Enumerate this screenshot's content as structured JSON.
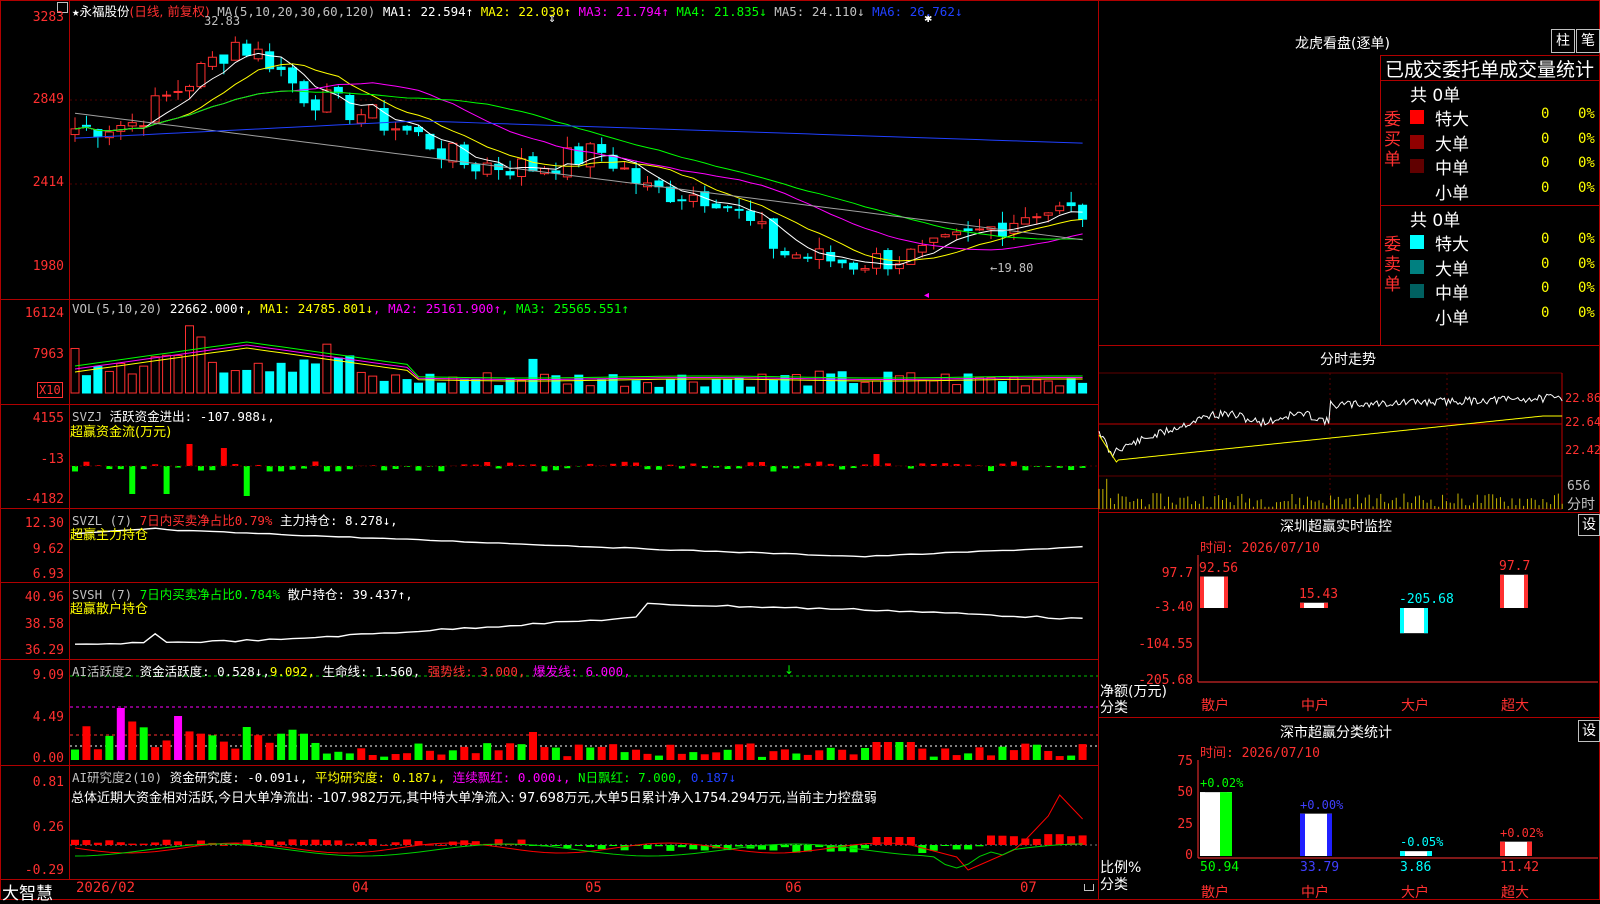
{
  "colors": {
    "up": "#ff3030",
    "down": "#00ffff",
    "frame": "#c00000",
    "text": "#c0c0c0",
    "white": "#ffffff",
    "yellow": "#ffff00",
    "magenta": "#ff00ff",
    "green": "#00d000",
    "blue": "#0000ff",
    "gray": "#a0a0a0"
  },
  "icons": {
    "corner": "corner-box-icon",
    "star": "star-icon",
    "lock": "lock-icon"
  },
  "main": {
    "stock_name": "永福股份",
    "period_label": "(日线, 前复权)",
    "ma_label": "MA(5,10,20,30,60,120)",
    "ma_values": [
      {
        "label": "MA1: 22.594↑",
        "color": "#ffffff"
      },
      {
        "label": "MA2: 22.030↑",
        "color": "#ffff00"
      },
      {
        "label": "MA3: 21.794↑",
        "color": "#ff00ff"
      },
      {
        "label": "MA4: 21.835↓",
        "color": "#00ff00"
      },
      {
        "label": "MA5: 24.110↓",
        "color": "#c0c0c0"
      },
      {
        "label": "MA6: 26.762↓",
        "color": "#2040ff"
      }
    ],
    "y_ticks": [
      "3283",
      "2849",
      "2414",
      "1980"
    ],
    "high_label": "32.83",
    "low_label": "←19.80"
  },
  "vol": {
    "title": "VOL(5,10,20)",
    "value": "22662.000↑",
    "ma_values": [
      {
        "label": "MA1: 24785.801↓",
        "color": "#ffff00"
      },
      {
        "label": "MA2: 25161.900↑",
        "color": "#ff00ff"
      },
      {
        "label": "MA3: 25565.551↑",
        "color": "#00ff00"
      }
    ],
    "y_ticks": [
      "16124",
      "7963"
    ],
    "unit": "X10"
  },
  "svzj": {
    "title": "SVZJ",
    "line": "活跃资金进出: -107.988↓,",
    "sub": "超赢资金流(万元)",
    "y_ticks": [
      "4155",
      "-13",
      "-4182"
    ]
  },
  "svzl": {
    "title": "SVZL (7)",
    "ratio": "7日内买卖净占比0.79%",
    "hold": "主力持仓: 8.278↓,",
    "sub": "超赢主力持仓",
    "y_ticks": [
      "12.30",
      "9.62",
      "6.93"
    ]
  },
  "svsh": {
    "title": "SVSH (7)",
    "ratio": "7日内买卖净占比0.784%",
    "hold": "散户持仓: 39.437↑,",
    "sub": "超赢散户持仓",
    "y_ticks": [
      "40.96",
      "38.58",
      "36.29"
    ]
  },
  "ai1": {
    "title": "AI活跃度2",
    "v1": "资金活跃度: 0.528↓,",
    "v2": "9.092,",
    "v3": "生命线: 1.560,",
    "v4": "强势线: 3.000,",
    "v5": "爆发线: 6.000,",
    "y_ticks": [
      "9.09",
      "4.49",
      "0.00"
    ]
  },
  "ai2": {
    "title": "AI研究度2(10)",
    "v1": "资金研究度: -0.091↓,",
    "v2": "平均研究度: 0.187↓,",
    "v3": "连续飘红: 0.000↓,",
    "v4": "N日飘红: 7.000,",
    "v5": "0.187↓",
    "summary": "总体近期大资金相对活跃,今日大单净流出: -107.982万元,其中特大单净流入: 97.698万元,大单5日累计净入1754.294万元,当前主力控盘弱",
    "y_ticks": [
      "0.81",
      "0.26",
      "-0.29"
    ]
  },
  "bottom": {
    "brand": "大智慧",
    "dates": [
      "2026/02",
      "04",
      "05",
      "06",
      "07"
    ]
  },
  "lhb": {
    "title": "龙虎看盘(逐单)",
    "btn1": "柱",
    "btn2": "笔",
    "header": "已成交委托单成交量统计",
    "buy_total": "共 0单",
    "sell_total": "共 0单",
    "buy_side": "委买单",
    "sell_side": "委卖单",
    "buy_rows": [
      {
        "label": "特大",
        "count": "0",
        "pct": "0%",
        "color": "#ff0000"
      },
      {
        "label": "大单",
        "count": "0",
        "pct": "0%",
        "color": "#900000"
      },
      {
        "label": "中单",
        "count": "0",
        "pct": "0%",
        "color": "#600000"
      },
      {
        "label": "小单",
        "count": "0",
        "pct": "0%",
        "color": "#000000"
      }
    ],
    "sell_rows": [
      {
        "label": "特大",
        "count": "0",
        "pct": "0%",
        "color": "#00ffff"
      },
      {
        "label": "大单",
        "count": "0",
        "pct": "0%",
        "color": "#008080"
      },
      {
        "label": "中单",
        "count": "0",
        "pct": "0%",
        "color": "#006060"
      },
      {
        "label": "小单",
        "count": "0",
        "pct": "0%",
        "color": "#000000"
      }
    ]
  },
  "intraday": {
    "title": "分时走势",
    "prices": [
      "22.86",
      "22.64",
      "22.42"
    ],
    "vol": "656",
    "vol_label": "分时"
  },
  "monitor": {
    "title": "深圳超赢实时监控",
    "set": "设",
    "time": "时间: 2026/07/10",
    "y_ticks": [
      "97.7",
      "-3.40",
      "-104.55",
      "-205.68"
    ],
    "unit": "净额(万元)",
    "class": "分类",
    "bars": [
      {
        "label": "散户",
        "value": 92.56,
        "text": "92.56"
      },
      {
        "label": "中户",
        "value": 15.43,
        "text": "15.43"
      },
      {
        "label": "大户",
        "value": -205.68,
        "text": "-205.68"
      },
      {
        "label": "超大",
        "value": 97.7,
        "text": "97.7"
      }
    ]
  },
  "classify": {
    "title": "深市超赢分类统计",
    "set": "设",
    "time": "时间: 2026/07/10",
    "y_ticks": [
      "75",
      "50",
      "25",
      "0"
    ],
    "unit": "比例%",
    "class": "分类",
    "bars": [
      {
        "label": "散户",
        "value": 50.94,
        "change": "+0.02%",
        "text": "50.94",
        "color": "#ffffff",
        "text_color": "#00ff00"
      },
      {
        "label": "中户",
        "value": 33.79,
        "change": "+0.00%",
        "text": "33.79",
        "color": "#2020ff",
        "text_color": "#4040ff"
      },
      {
        "label": "大户",
        "value": 3.86,
        "change": "-0.05%",
        "text": "3.86",
        "color": "#00ffff",
        "text_color": "#00ffff"
      },
      {
        "label": "超大",
        "value": 11.42,
        "change": "+0.02%",
        "text": "11.42",
        "color": "#ff3030",
        "text_color": "#ff3030"
      }
    ]
  }
}
